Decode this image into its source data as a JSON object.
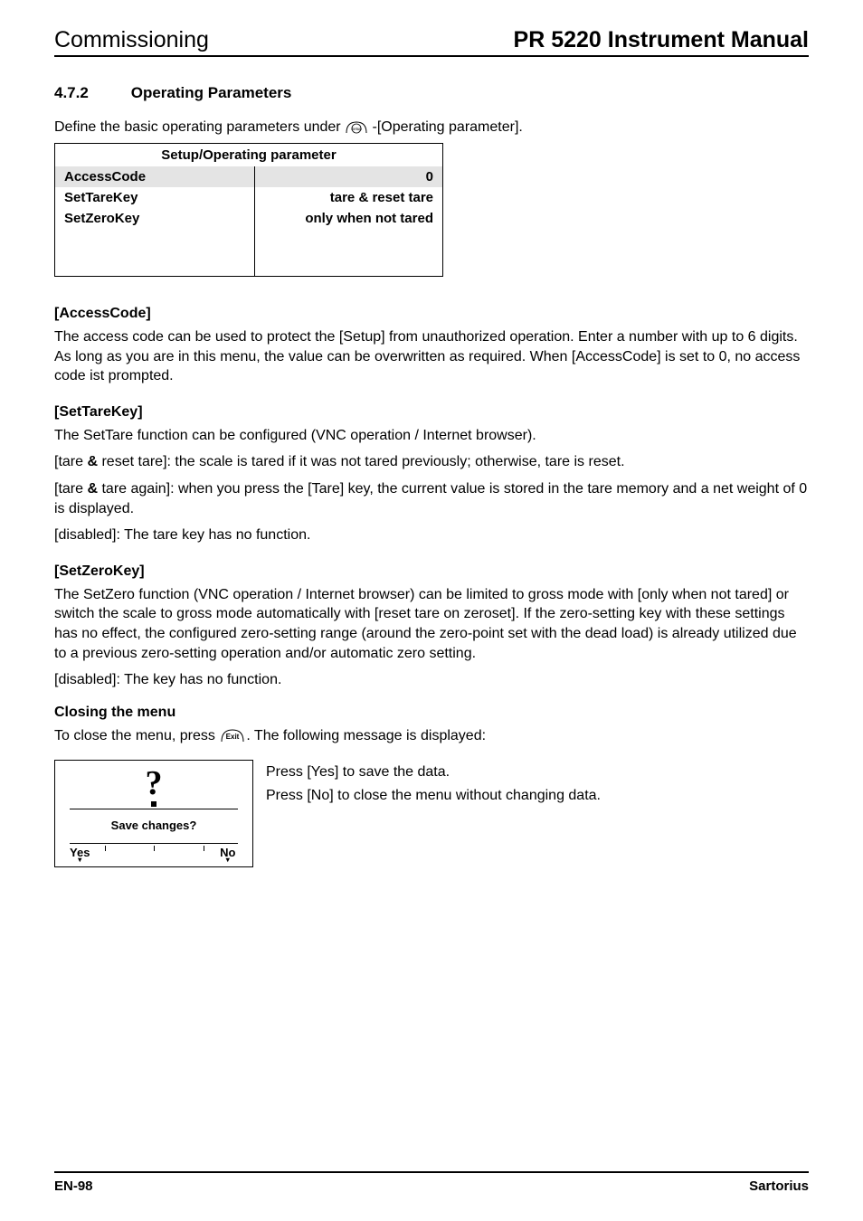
{
  "header": {
    "left": "Commissioning",
    "right": "PR 5220 Instrument Manual"
  },
  "section": {
    "number": "4.7.2",
    "title": "Operating Parameters"
  },
  "intro": {
    "before": "Define the basic operating parameters under ",
    "after": "-[Operating parameter]."
  },
  "paramTable": {
    "title": "Setup/Operating parameter",
    "rows": [
      {
        "label": "AccessCode",
        "value": "0",
        "shaded": true
      },
      {
        "label": "SetTareKey",
        "value_prefix": "tare ",
        "amp": "&",
        "value_suffix": " reset tare",
        "shaded": false
      },
      {
        "label": "SetZeroKey",
        "value": "only when not tared",
        "shaded": false
      }
    ]
  },
  "accessCode": {
    "heading": "[AccessCode]",
    "text": "The access code can be used to protect the [Setup] from unauthorized operation. Enter a number with up to 6 digits. As long as you are in this menu, the value can be overwritten as required. When [AccessCode] is set to 0, no access code ist prompted."
  },
  "setTareKey": {
    "heading": "[SetTareKey]",
    "p1": "The SetTare function can be configured (VNC operation / Internet browser).",
    "p2_prefix": "[tare ",
    "p2_amp": "&",
    "p2_suffix": " reset tare]: the scale is tared if it was not tared previously; otherwise, tare is reset.",
    "p3_prefix": "[tare ",
    "p3_amp": "&",
    "p3_suffix": " tare again]: when you press the [Tare] key, the current value is stored in the tare memory and a net weight of 0 is displayed.",
    "p4": "[disabled]: The tare key has no function."
  },
  "setZeroKey": {
    "heading": "[SetZeroKey]",
    "p1": "The SetZero function (VNC operation / Internet browser) can be limited to gross mode with [only when not tared] or switch the scale to gross mode automatically with [reset tare on zeroset]. If the zero-setting key with these settings has no effect, the configured zero-setting range (around the zero-point set with the dead load) is already utilized due to a previous zero-setting operation and/or automatic zero setting.",
    "p2": "[disabled]: The key has no function."
  },
  "closing": {
    "heading": "Closing the menu",
    "line_before": "To close the menu, press ",
    "exit_label": "Exit",
    "line_after": ". The following message is displayed:",
    "yesText": "Press [Yes] to save the data.",
    "noText": "Press [No] to close the menu without changing data."
  },
  "dialog": {
    "message": "Save changes?",
    "yes": "Yes",
    "no": "No"
  },
  "footer": {
    "left": "EN-98",
    "right": "Sartorius"
  }
}
